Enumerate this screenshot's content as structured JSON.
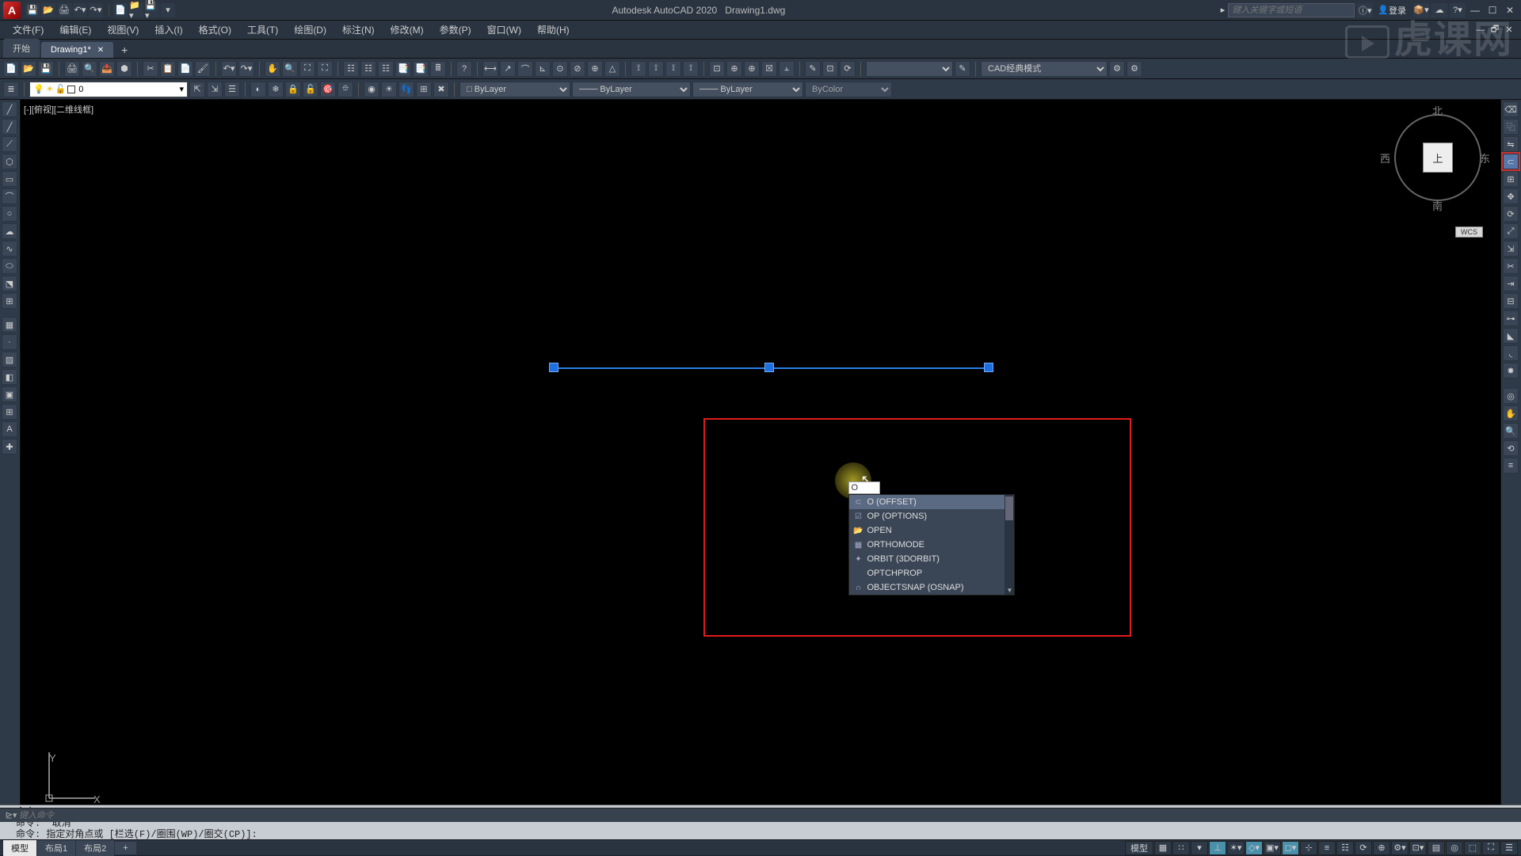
{
  "title": {
    "app": "Autodesk AutoCAD 2020",
    "file": "Drawing1.dwg"
  },
  "search_placeholder": "键入关键字或短语",
  "login_label": "登录",
  "menus": [
    "文件(F)",
    "编辑(E)",
    "视图(V)",
    "插入(I)",
    "格式(O)",
    "工具(T)",
    "绘图(D)",
    "标注(N)",
    "修改(M)",
    "参数(P)",
    "窗口(W)",
    "帮助(H)"
  ],
  "filetabs": {
    "start": "开始",
    "doc": "Drawing1*"
  },
  "layer": {
    "current": "0"
  },
  "props": {
    "color": "ByLayer",
    "ltype": "ByLayer",
    "lweight": "ByLayer",
    "plot": "ByColor"
  },
  "workspace_select": "CAD经典模式",
  "viewport_label": "[-][俯视][二维线框]",
  "viewcube": {
    "n": "北",
    "s": "南",
    "e": "东",
    "w": "西",
    "top": "上",
    "wcs": "WCS"
  },
  "ucs": {
    "x": "X",
    "y": "Y"
  },
  "autocomplete": {
    "input_value": "O",
    "items": [
      {
        "icon": "⊂",
        "label": "O (OFFSET)",
        "sel": true
      },
      {
        "icon": "☑",
        "label": "OP (OPTIONS)"
      },
      {
        "icon": "📂",
        "label": "OPEN"
      },
      {
        "icon": "▦",
        "label": "ORTHOMODE"
      },
      {
        "icon": "✦",
        "label": "ORBIT (3DORBIT)"
      },
      {
        "icon": "",
        "label": "OPTCHPROP"
      },
      {
        "icon": "∩",
        "label": "OBJECTSNAP (OSNAP)"
      }
    ]
  },
  "cmdlines": [
    "命令:",
    "命令: *取消*",
    "命令: 指定对角点或 [栏选(F)/圈围(WP)/圈交(CP)]:"
  ],
  "cmd_placeholder": "键入命令",
  "model_tabs": {
    "model": "模型",
    "l1": "布局1",
    "l2": "布局2"
  },
  "status_left": "模型"
}
